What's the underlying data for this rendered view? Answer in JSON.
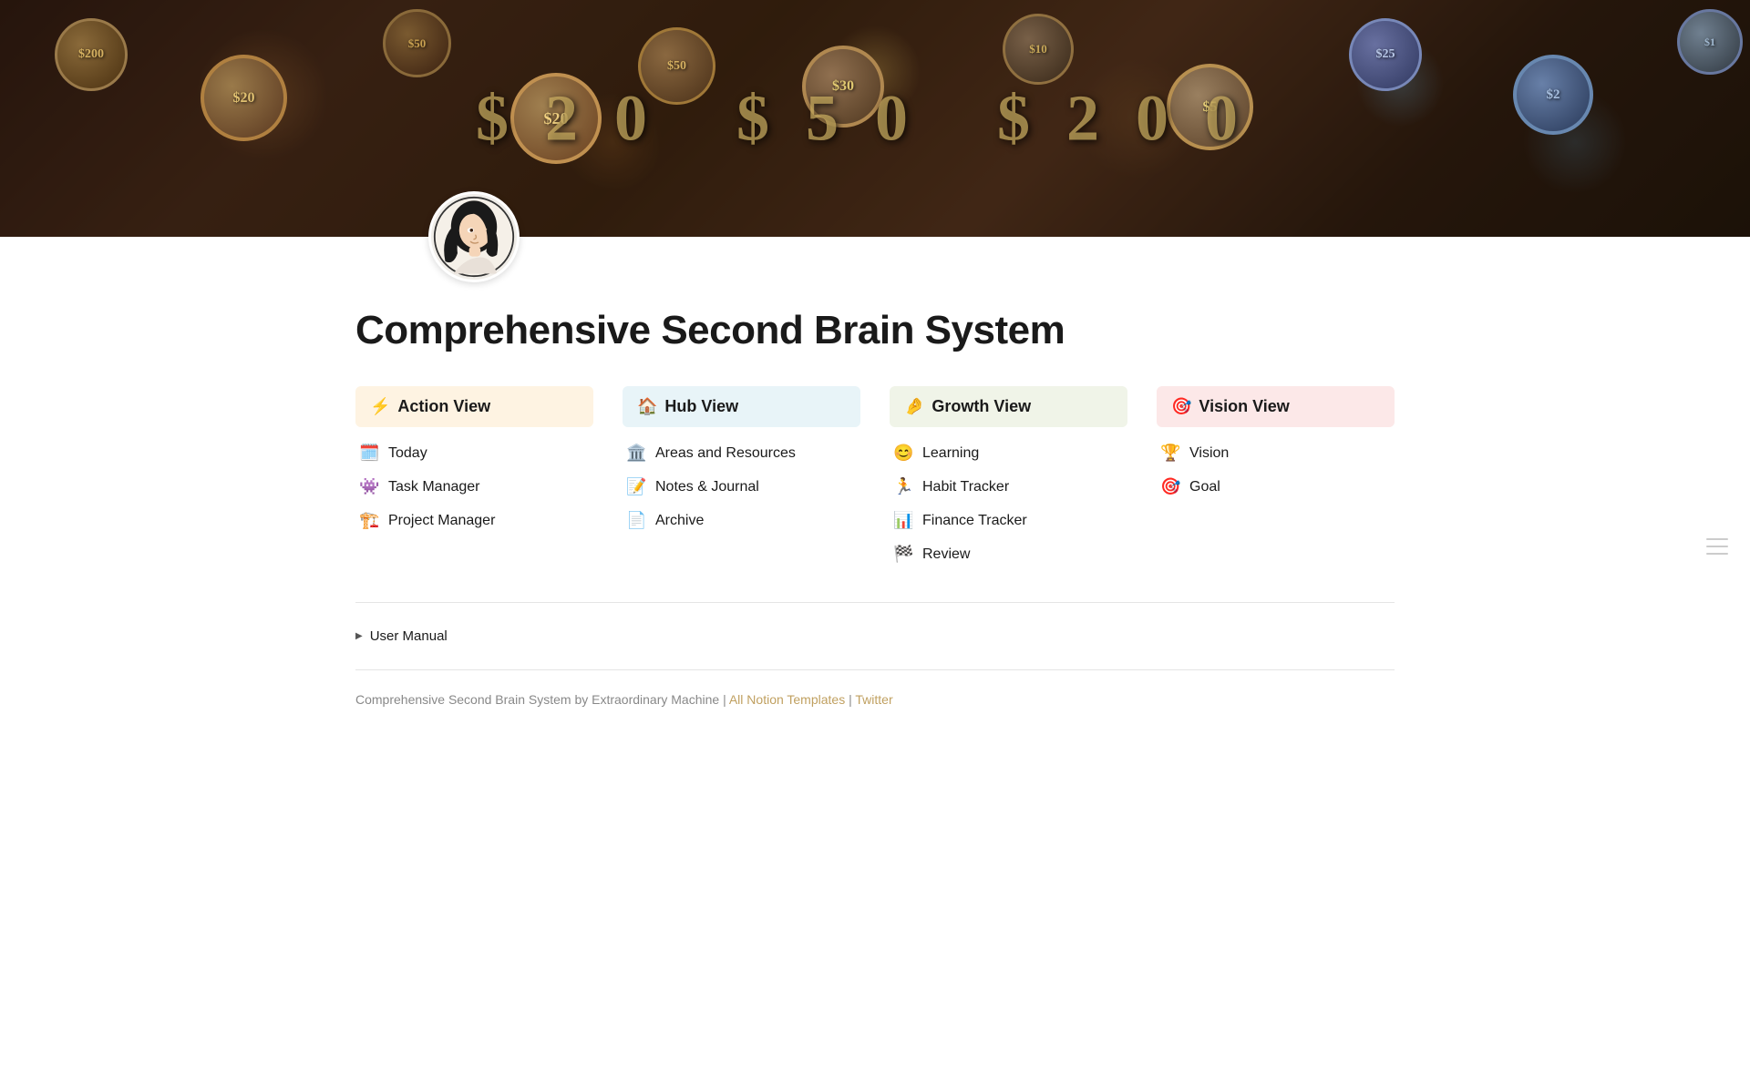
{
  "hero": {
    "alt": "Cash register buttons background"
  },
  "avatar": {
    "alt": "Profile avatar - woman with dark hair"
  },
  "page": {
    "title": "Comprehensive Second Brain System"
  },
  "columns": [
    {
      "id": "action",
      "header_emoji": "⚡",
      "header_label": "Action View",
      "theme": "action",
      "items": [
        {
          "emoji": "🗓️",
          "label": "Today"
        },
        {
          "emoji": "👾",
          "label": "Task Manager"
        },
        {
          "emoji": "🏗️",
          "label": "Project Manager"
        }
      ]
    },
    {
      "id": "hub",
      "header_emoji": "🏠",
      "header_label": "Hub View",
      "theme": "hub",
      "items": [
        {
          "emoji": "🏛️",
          "label": "Areas and Resources"
        },
        {
          "emoji": "📝",
          "label": "Notes & Journal"
        },
        {
          "emoji": "📄",
          "label": "Archive"
        }
      ]
    },
    {
      "id": "growth",
      "header_emoji": "🤌",
      "header_label": "Growth View",
      "theme": "growth",
      "items": [
        {
          "emoji": "😊",
          "label": "Learning"
        },
        {
          "emoji": "🏃",
          "label": "Habit Tracker"
        },
        {
          "emoji": "📊",
          "label": "Finance Tracker"
        },
        {
          "emoji": "🏁",
          "label": "Review"
        }
      ]
    },
    {
      "id": "vision",
      "header_emoji": "🎯",
      "header_label": "Vision View",
      "theme": "vision",
      "items": [
        {
          "emoji": "🏆",
          "label": "Vision"
        },
        {
          "emoji": "🎯",
          "label": "Goal"
        }
      ]
    }
  ],
  "user_manual": {
    "label": "User Manual"
  },
  "footer": {
    "prefix": "Comprehensive Second Brain System by Extraordinary Machine |",
    "link1_label": "All Notion Templates",
    "separator": "|",
    "link2_label": "Twitter"
  }
}
